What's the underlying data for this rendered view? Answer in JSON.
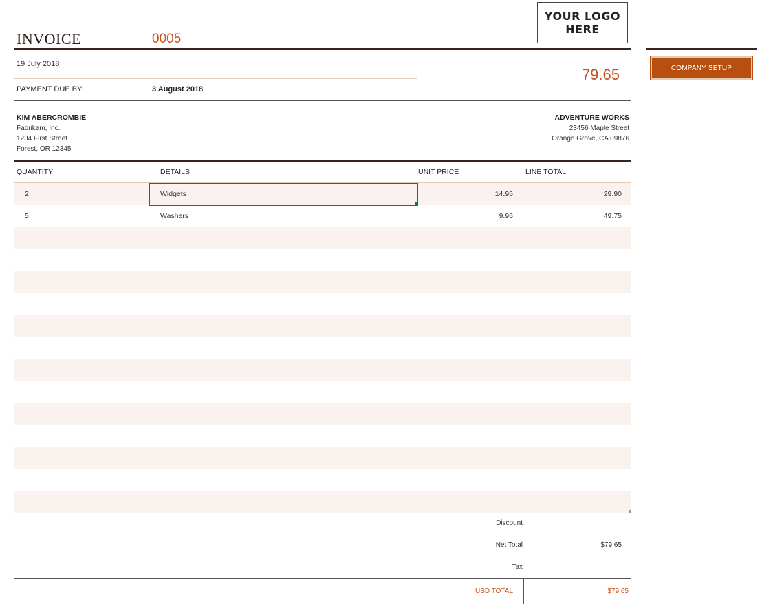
{
  "header": {
    "title": "INVOICE",
    "number": "0005",
    "logo_line1": "YOUR LOGO",
    "logo_line2": "HERE",
    "date": "19 July 2018",
    "total": "79.65",
    "due_label": "PAYMENT DUE BY:",
    "due_value": "3 August 2018"
  },
  "sidebar": {
    "company_setup_label": "COMPANY SETUP"
  },
  "bill_to": {
    "name": "KIM ABERCROMBIE",
    "company": "Fabrikam, Inc.",
    "street": "1234 First Street",
    "city": "Forest, OR 12345"
  },
  "from": {
    "name": "ADVENTURE WORKS",
    "street": "23456 Maple Street",
    "city": "Orange Grove, CA 09876"
  },
  "table": {
    "headers": [
      "QUANTITY",
      "DETAILS",
      "UNIT PRICE",
      "LINE TOTAL"
    ],
    "rows": [
      {
        "qty": "2",
        "details": "Widgets",
        "unit": "14.95",
        "line": "29.90"
      },
      {
        "qty": "5",
        "details": "Washers",
        "unit": "9.95",
        "line": "49.75"
      }
    ]
  },
  "totals": {
    "discount_label": "Discount",
    "net_label": "Net Total",
    "net_value": "$79.65",
    "tax_label": "Tax",
    "grand_label": "USD TOTAL",
    "grand_value": "$79.65"
  },
  "colors": {
    "accent": "#c8501a",
    "button": "#b94f0f",
    "rule": "#3a2420",
    "row_shade": "#f9f2ef",
    "selection": "#1f6f47"
  }
}
